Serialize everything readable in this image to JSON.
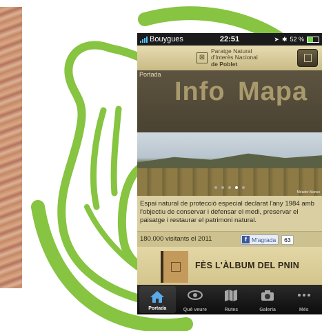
{
  "status": {
    "carrier": "Bouygues",
    "time": "22:51",
    "battery": "52 %",
    "battery_level": 0.52
  },
  "header": {
    "line1": "Paratge Natural",
    "line2": "d'Interès Nacional",
    "line3": "de Poblet"
  },
  "section": {
    "breadcrumb": "Portada",
    "word1": "Info",
    "word2": "Mapa"
  },
  "photo": {
    "credit": "Mirador Manso"
  },
  "carousel": {
    "count": 5,
    "active": 4
  },
  "description": "Espai natural de protecció especial declarat l'any 1984 amb l'objectiu de conservar i defensar el medi, preservar el paisatge i restaurar el patrimoni natural.",
  "stats": {
    "visits": "180.000 visitants el 2011",
    "like_label": "M'agrada",
    "like_count": "63"
  },
  "album": {
    "label": "FÈS L'ÀLBUM DEL PNIN"
  },
  "tabs": [
    {
      "label": "Portada",
      "icon": "home-icon"
    },
    {
      "label": "Què veure",
      "icon": "eye-icon"
    },
    {
      "label": "Rutes",
      "icon": "map-icon"
    },
    {
      "label": "Galeria",
      "icon": "camera-icon"
    },
    {
      "label": "Més",
      "icon": "more-icon"
    }
  ],
  "colors": {
    "logo_green": "#86c441",
    "fb_blue": "#3b5998",
    "tab_active": "#5aaae8"
  }
}
